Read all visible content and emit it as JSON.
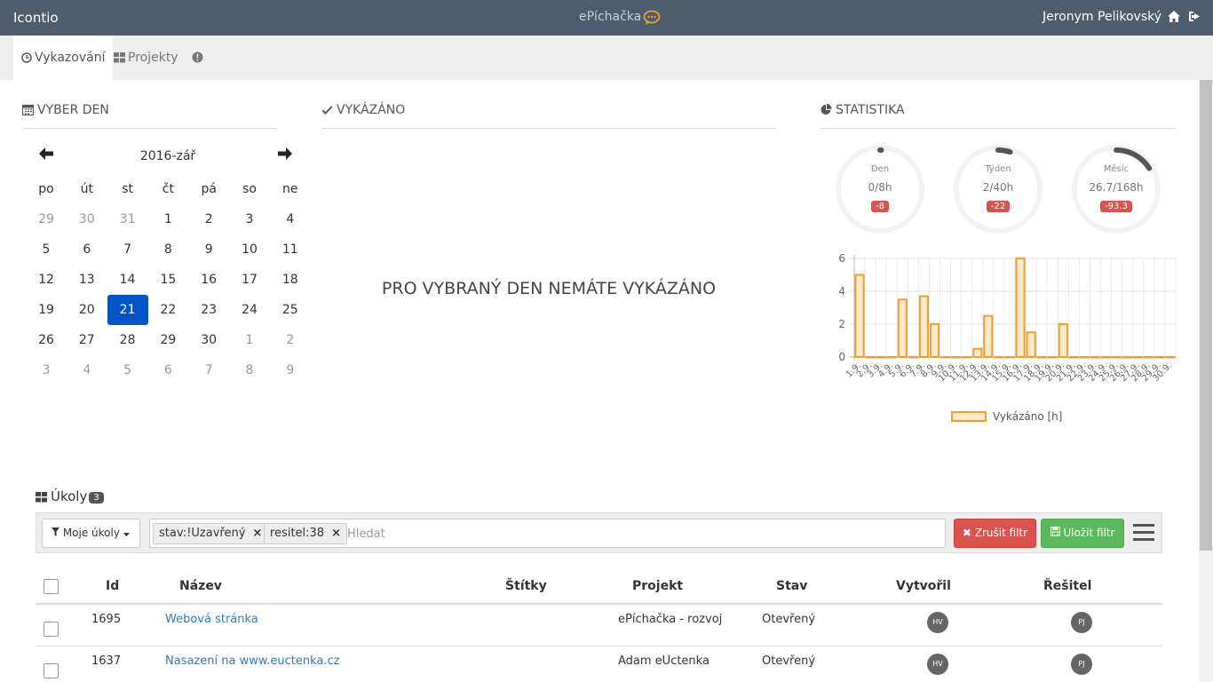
{
  "header": {
    "brand": "Icontio",
    "app_title": "ePíchačka",
    "user": "Jeronym Pelikovský"
  },
  "tabs": [
    {
      "label": "Vykazování",
      "active": true
    },
    {
      "label": "Projekty",
      "active": false
    }
  ],
  "calendar": {
    "heading": "VYBER DEN",
    "month": "2016-zář",
    "weekdays": [
      "po",
      "út",
      "st",
      "čt",
      "pá",
      "so",
      "ne"
    ],
    "weeks": [
      [
        "29",
        "30",
        "31",
        "1",
        "2",
        "3",
        "4"
      ],
      [
        "5",
        "6",
        "7",
        "8",
        "9",
        "10",
        "11"
      ],
      [
        "12",
        "13",
        "14",
        "15",
        "16",
        "17",
        "18"
      ],
      [
        "19",
        "20",
        "21",
        "22",
        "23",
        "24",
        "25"
      ],
      [
        "26",
        "27",
        "28",
        "29",
        "30",
        "1",
        "2"
      ],
      [
        "3",
        "4",
        "5",
        "6",
        "7",
        "8",
        "9"
      ]
    ],
    "selected_day": "21"
  },
  "reported": {
    "heading": "VYKÁZÁNO",
    "empty_message": "PRO VYBRANÝ DEN NEMÁTE VYKÁZÁNO"
  },
  "stats": {
    "heading": "STATISTIKA",
    "gauges": [
      {
        "label": "Den",
        "value": "0/8h",
        "diff": "-8",
        "fraction": 0
      },
      {
        "label": "Týden",
        "value": "2/40h",
        "diff": "-22",
        "fraction": 0.05
      },
      {
        "label": "Měsíc",
        "value": "26.7/168h",
        "diff": "-93.3",
        "fraction": 0.16
      }
    ],
    "accent_color": "#f0a030",
    "badge_color": "#d9534f"
  },
  "chart_data": {
    "type": "bar",
    "categories": [
      "1.9.",
      "2.9.",
      "3.9.",
      "4.9.",
      "5.9.",
      "6.9.",
      "7.9.",
      "8.9.",
      "9.9.",
      "10.9.",
      "11.9.",
      "12.9.",
      "13.9.",
      "14.9.",
      "15.9.",
      "16.9.",
      "17.9.",
      "18.9.",
      "19.9.",
      "20.9.",
      "21.9.",
      "22.9.",
      "23.9.",
      "24.9.",
      "25.9.",
      "26.9.",
      "27.9.",
      "28.9.",
      "29.9.",
      "30.9."
    ],
    "series": [
      {
        "name": "Vykázáno [h]",
        "values": [
          5,
          0,
          0,
          0,
          3.5,
          0,
          3.7,
          2,
          0,
          0,
          0,
          0.5,
          2.5,
          0,
          0,
          6,
          1.5,
          0,
          0,
          2,
          0,
          0,
          0,
          0,
          0,
          0,
          0,
          0,
          0,
          0
        ]
      }
    ],
    "ylim": [
      0,
      6
    ],
    "yticks": [
      "0",
      "2",
      "4",
      "6"
    ],
    "grid": true,
    "legend": "bottom"
  },
  "tasks": {
    "title": "Úkoly",
    "count": "3",
    "filter": {
      "mine_label": "Moje úkoly",
      "chips": [
        "stav:!Uzavřený",
        "resitel:38"
      ],
      "search_placeholder": "Hledat",
      "cancel_label": "Zrušit filtr",
      "save_label": "Uložit filtr"
    },
    "columns": [
      "Id",
      "Název",
      "Štítky",
      "Projekt",
      "Stav",
      "Vytvořil",
      "Řešitel"
    ],
    "rows": [
      {
        "id": "1695",
        "name": "Webová stránka",
        "tags": "",
        "project": "ePíchačka - rozvoj",
        "status": "Otevřený",
        "creator": "HV",
        "assignee": "PJ"
      },
      {
        "id": "1637",
        "name": "Nasazení na www.euctenka.cz",
        "tags": "",
        "project": "Adam eUctenka",
        "status": "Otevřený",
        "creator": "HV",
        "assignee": "PJ"
      }
    ]
  }
}
